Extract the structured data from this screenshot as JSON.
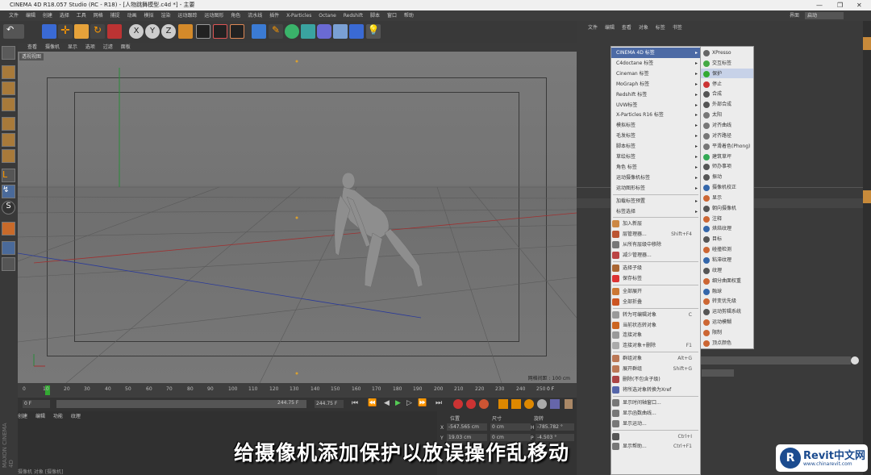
{
  "window": {
    "title": "CINEMA 4D R18.057 Studio (RC - R18) - [人物跳舞模型.c4d *] - 主要"
  },
  "menubar": [
    "文件",
    "编辑",
    "创建",
    "选择",
    "工具",
    "网格",
    "捕捉",
    "动画",
    "模拟",
    "渲染",
    "运动跟踪",
    "运动图形",
    "角色",
    "流水线",
    "插件",
    "X-Particles",
    "Octane",
    "Redshift",
    "脚本",
    "窗口",
    "帮助"
  ],
  "menubar_right": {
    "interface_label": "界面",
    "interface_value": "启动"
  },
  "viewport": {
    "menu": [
      "查看",
      "摄像机",
      "显示",
      "选项",
      "过滤",
      "面板"
    ],
    "tag": "透视视图",
    "grid_info": "网格间距 : 100 cm"
  },
  "timeline": {
    "ticks": [
      "0",
      "10",
      "20",
      "30",
      "40",
      "50",
      "60",
      "70",
      "80",
      "90",
      "100",
      "110",
      "120",
      "130",
      "140",
      "150",
      "160",
      "170",
      "180",
      "190",
      "200",
      "210",
      "220",
      "230",
      "240",
      "250"
    ],
    "end": "0 F"
  },
  "transport": {
    "start": "0 F",
    "end1": "244.75 F",
    "end2": "244.75 F"
  },
  "bottom_menu": [
    "创建",
    "编辑",
    "功能",
    "纹理"
  ],
  "coords": {
    "header": [
      "位置",
      "尺寸",
      "旋转"
    ],
    "x": "-547.565 cm",
    "size_x": "0 cm",
    "h": "-785.782 °",
    "y": "19.03 cm",
    "size_y": "0 cm",
    "p": "-4.503 °"
  },
  "status": "摄像机 对象 [摄像机]",
  "right_panel": {
    "header": [
      "文件",
      "编辑",
      "查看",
      "对象",
      "标签",
      "书签"
    ]
  },
  "context_menu": [
    {
      "label": "CINEMA 4D 标签",
      "arrow": true,
      "highlight": true
    },
    {
      "label": "C4doctane 标签",
      "arrow": true
    },
    {
      "label": "Cineman 标签",
      "arrow": true
    },
    {
      "label": "MoGraph 标签",
      "arrow": true
    },
    {
      "label": "Redshift 标签",
      "arrow": true
    },
    {
      "label": "UVW标签",
      "arrow": true
    },
    {
      "label": "X-Particles R16 标签",
      "arrow": true
    },
    {
      "label": "模拟标签",
      "arrow": true
    },
    {
      "label": "毛发标签",
      "arrow": true
    },
    {
      "label": "脚本标签",
      "arrow": true
    },
    {
      "label": "草绘标签",
      "arrow": true
    },
    {
      "label": "角色 标签",
      "arrow": true
    },
    {
      "label": "运动摄像机标签",
      "arrow": true
    },
    {
      "label": "运动图形标签",
      "arrow": true
    },
    {
      "label": "加载标签预置",
      "arrow": true,
      "sep": true
    },
    {
      "label": "标签选择",
      "arrow": true
    },
    {
      "label": "加入新层",
      "icon": "#c84",
      "sep": true
    },
    {
      "label": "层管理器...",
      "shortcut": "Shift+F4",
      "icon": "#b53"
    },
    {
      "label": "从所有层级中移除",
      "icon": "#777"
    },
    {
      "label": "减少管理器...",
      "icon": "#b44"
    },
    {
      "label": "选择子级",
      "icon": "#a63",
      "sep": true
    },
    {
      "label": "保存标签",
      "icon": "#d33"
    },
    {
      "label": "全部展开",
      "icon": "#c73",
      "sep": true
    },
    {
      "label": "全部折叠",
      "icon": "#c52"
    },
    {
      "label": "转为可编辑对象",
      "shortcut": "C",
      "icon": "#999",
      "sep": true
    },
    {
      "label": "当前状态转对象",
      "icon": "#c62"
    },
    {
      "label": "连接对象",
      "icon": "#999"
    },
    {
      "label": "连接对象+删除",
      "shortcut": "F1",
      "icon": "#aaa"
    },
    {
      "label": "群组对象",
      "shortcut": "Alt+G",
      "icon": "#b75",
      "sep": true
    },
    {
      "label": "展开群组",
      "shortcut": "Shift+G",
      "icon": "#b75"
    },
    {
      "label": "删除(不包含子级)",
      "icon": "#a44"
    },
    {
      "label": "将所选对象转换为Xref",
      "icon": "#56a"
    },
    {
      "label": "显示时间轴窗口...",
      "icon": "#777",
      "sep": true
    },
    {
      "label": "显示函数曲线...",
      "icon": "#777"
    },
    {
      "label": "显示运动...",
      "icon": "#777"
    },
    {
      "label": "",
      "shortcut": "Ctrl+I",
      "icon": "#555",
      "sep": true
    },
    {
      "label": "显示帮助...",
      "shortcut": "Ctrl+F1",
      "icon": "#777"
    }
  ],
  "submenu": [
    {
      "label": "XPresso",
      "color": "#666"
    },
    {
      "label": "交互标签",
      "color": "#4a4"
    },
    {
      "label": "保护",
      "color": "#3a3",
      "highlight": true
    },
    {
      "label": "停止",
      "color": "#c33"
    },
    {
      "label": "合成",
      "color": "#555"
    },
    {
      "label": "外部合成",
      "color": "#555"
    },
    {
      "label": "太阳",
      "color": "#777"
    },
    {
      "label": "对齐曲线",
      "color": "#777"
    },
    {
      "label": "对齐路径",
      "color": "#777"
    },
    {
      "label": "平滑着色(Phong)",
      "color": "#777"
    },
    {
      "label": "建筑草坪",
      "color": "#3a5"
    },
    {
      "label": "师办事项",
      "color": "#555"
    },
    {
      "label": "振动",
      "color": "#555"
    },
    {
      "label": "摄像机校正",
      "color": "#36a"
    },
    {
      "label": "显示",
      "color": "#c63"
    },
    {
      "label": "朝向摄像机",
      "color": "#555"
    },
    {
      "label": "注释",
      "color": "#c63"
    },
    {
      "label": "烘焙纹理",
      "color": "#36a"
    },
    {
      "label": "目标",
      "color": "#555"
    },
    {
      "label": "碰撞检测",
      "color": "#c63"
    },
    {
      "label": "粘滞纹理",
      "color": "#36a"
    },
    {
      "label": "纹理",
      "color": "#555"
    },
    {
      "label": "细分曲面权重",
      "color": "#c63"
    },
    {
      "label": "融球",
      "color": "#36a"
    },
    {
      "label": "转变优先级",
      "color": "#c63"
    },
    {
      "label": "运动剪辑系统",
      "color": "#555"
    },
    {
      "label": "运动模糊",
      "color": "#c63"
    },
    {
      "label": "限制",
      "color": "#c63"
    },
    {
      "label": "顶点颜色",
      "color": "#c63"
    }
  ],
  "subtitle": "给摄像机添加保护以放误操作乱移动",
  "logo": {
    "title": "Revit中文网",
    "url": "www.chinarevit.com",
    "mark": "R"
  }
}
